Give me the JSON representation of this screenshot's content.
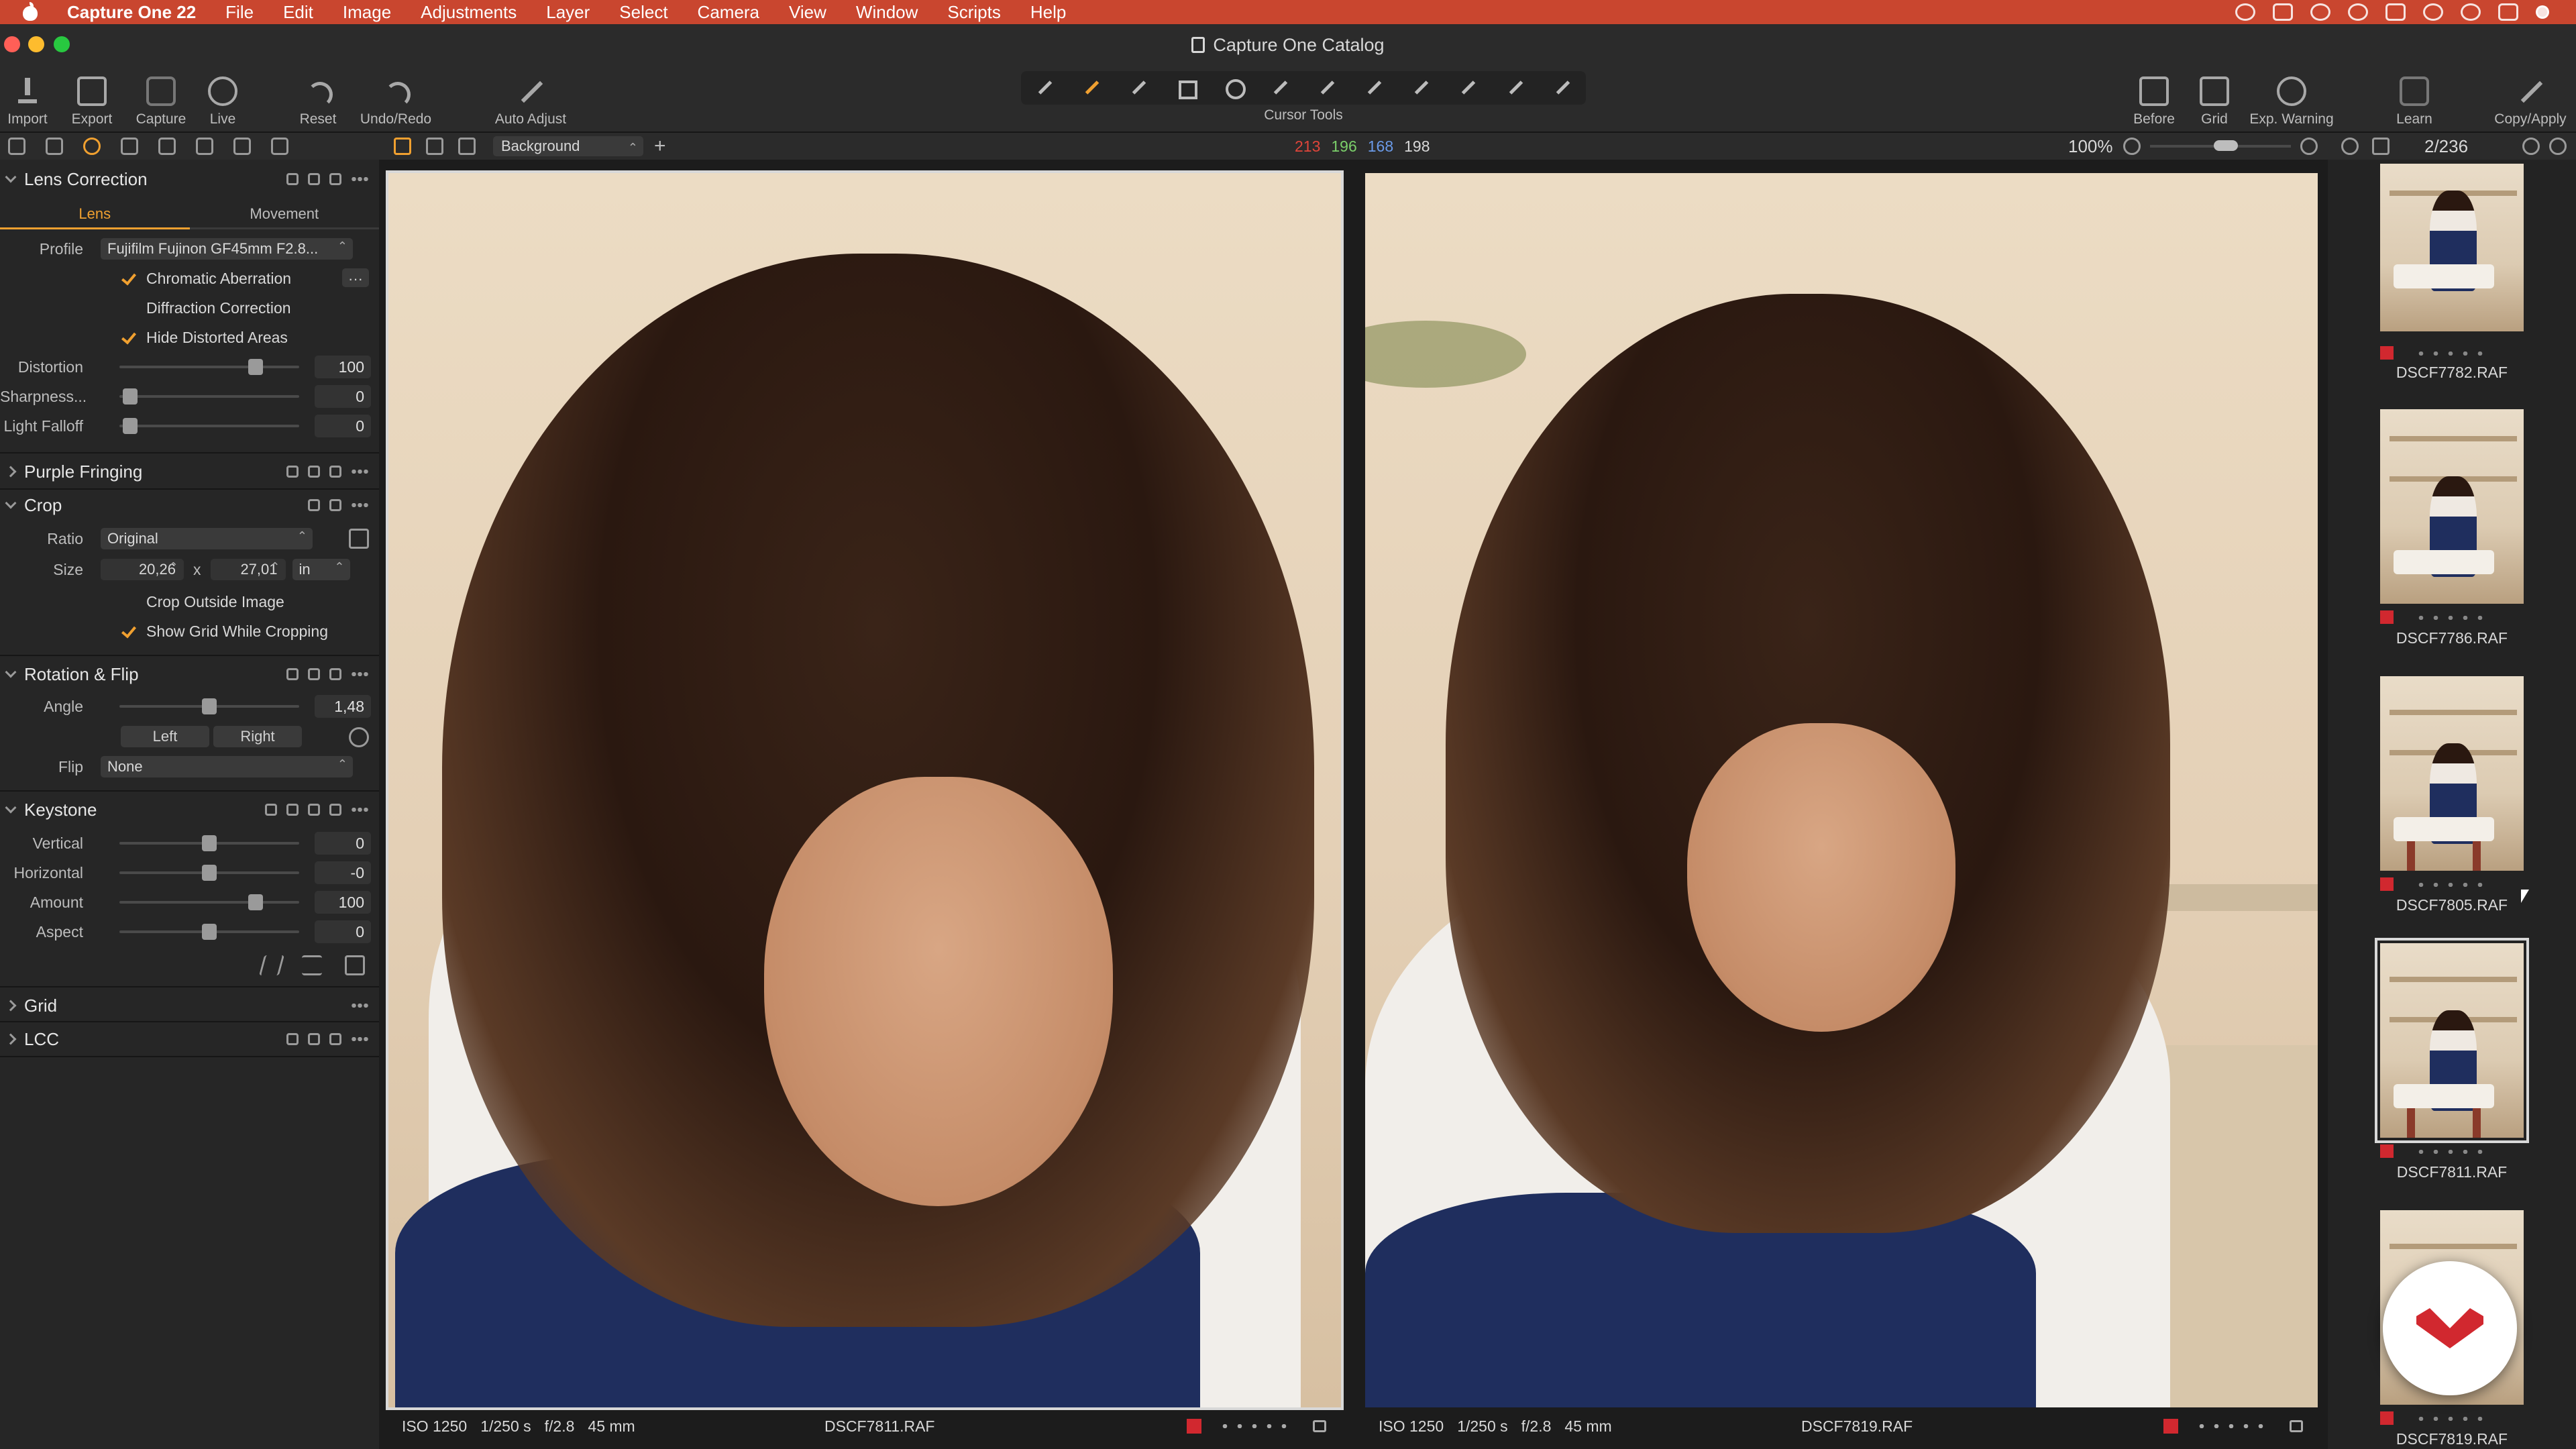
{
  "menubar": {
    "app_name": "Capture One 22",
    "items": [
      "File",
      "Edit",
      "Image",
      "Adjustments",
      "Layer",
      "Select",
      "Camera",
      "View",
      "Window",
      "Scripts",
      "Help"
    ]
  },
  "window": {
    "title": "Capture One Catalog"
  },
  "toolbar": {
    "import": "Import",
    "export": "Export",
    "capture": "Capture",
    "live": "Live",
    "reset": "Reset",
    "undo_redo": "Undo/Redo",
    "auto_adjust": "Auto Adjust",
    "cursor_tools": "Cursor Tools",
    "before": "Before",
    "grid": "Grid",
    "exp_warning": "Exp. Warning",
    "learn": "Learn",
    "copy_apply": "Copy/Apply"
  },
  "viewer_bar": {
    "background_select": "Background",
    "rgb": {
      "r": "213",
      "g": "196",
      "b": "168",
      "l": "198"
    },
    "rgb_colors": {
      "r": "#e0453a",
      "g": "#7bd06a",
      "b": "#6a9ae8",
      "l": "#d8d8d8"
    },
    "zoom": "100%"
  },
  "filmstrip_bar": {
    "count": "2/236"
  },
  "lens_correction": {
    "title": "Lens Correction",
    "tabs": [
      "Lens",
      "Movement"
    ],
    "profile_label": "Profile",
    "profile_value": "Fujifilm Fujinon GF45mm F2.8...",
    "chromatic_aberration": "Chromatic Aberration",
    "diffraction_correction": "Diffraction Correction",
    "hide_distorted_areas": "Hide Distorted Areas",
    "distortion_label": "Distortion",
    "distortion_value": "100",
    "sharpness_label": "Sharpness...",
    "sharpness_value": "0",
    "light_falloff_label": "Light Falloff",
    "light_falloff_value": "0"
  },
  "purple_fringing": {
    "title": "Purple Fringing"
  },
  "crop": {
    "title": "Crop",
    "ratio_label": "Ratio",
    "ratio_value": "Original",
    "size_label": "Size",
    "width": "20,26",
    "x": "x",
    "height": "27,01",
    "unit": "in",
    "crop_outside": "Crop Outside Image",
    "show_grid": "Show Grid While Cropping"
  },
  "rotation_flip": {
    "title": "Rotation & Flip",
    "angle_label": "Angle",
    "angle_value": "1,48",
    "left": "Left",
    "right": "Right",
    "flip_label": "Flip",
    "flip_value": "None"
  },
  "keystone": {
    "title": "Keystone",
    "vertical_label": "Vertical",
    "vertical_value": "0",
    "horizontal_label": "Horizontal",
    "horizontal_value": "-0",
    "amount_label": "Amount",
    "amount_value": "100",
    "aspect_label": "Aspect",
    "aspect_value": "0"
  },
  "grid_section": {
    "title": "Grid"
  },
  "lcc_section": {
    "title": "LCC"
  },
  "slider_levels": {
    "distortion": 0.78,
    "sharpness": 0.02,
    "light_falloff": 0.02,
    "angle": 0.5,
    "vertical": 0.5,
    "horizontal": 0.5,
    "amount": 0.78,
    "aspect": 0.5
  },
  "viewer": {
    "left": {
      "iso": "ISO 1250",
      "shutter": "1/250 s",
      "aperture": "f/2.8",
      "focal": "45 mm",
      "filename": "DSCF7811.RAF"
    },
    "right": {
      "iso": "ISO 1250",
      "shutter": "1/250 s",
      "aperture": "f/2.8",
      "focal": "45 mm",
      "filename": "DSCF7819.RAF"
    }
  },
  "filmstrip": {
    "items": [
      {
        "name": "DSCF7782.RAF"
      },
      {
        "name": "DSCF7786.RAF"
      },
      {
        "name": "DSCF7805.RAF"
      },
      {
        "name": "DSCF7811.RAF"
      },
      {
        "name": "DSCF7819.RAF"
      }
    ]
  },
  "colors": {
    "accent": "#f0a030",
    "menubar": "#c9462f",
    "color_tag": "#d1282f"
  }
}
